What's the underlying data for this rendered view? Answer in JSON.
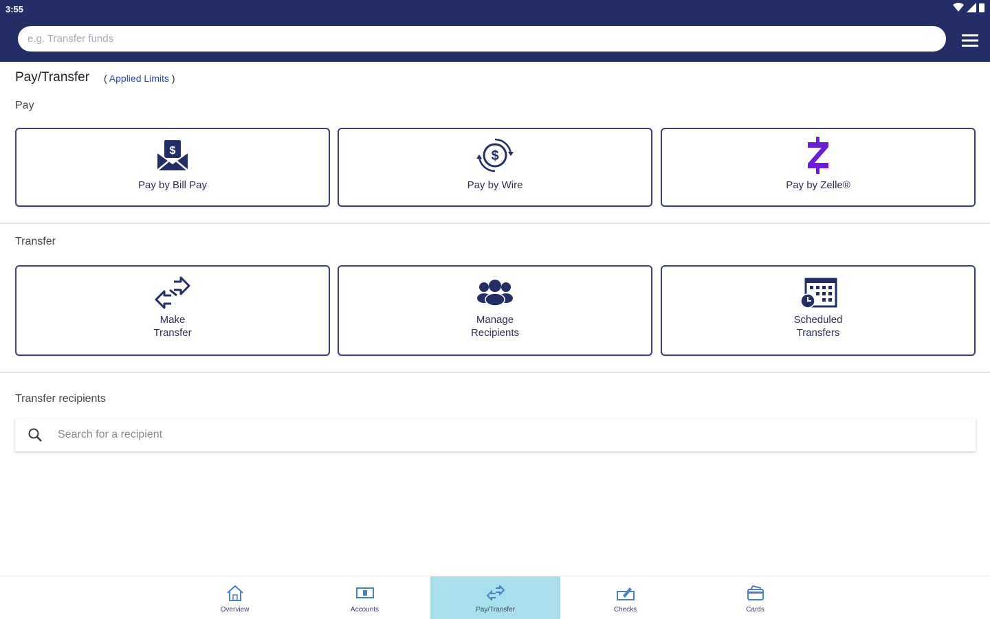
{
  "status_bar": {
    "time": "3:55"
  },
  "header": {
    "search_placeholder": "e.g. Transfer funds"
  },
  "page": {
    "title": "Pay/Transfer",
    "applied_limits_open": "( ",
    "applied_limits_link": "Applied Limits",
    "applied_limits_close": " )"
  },
  "pay_section": {
    "label": "Pay",
    "tiles": [
      {
        "label": "Pay by Bill Pay",
        "icon": "bill-pay-envelope-icon"
      },
      {
        "label": "Pay by Wire",
        "icon": "wire-dollar-icon"
      },
      {
        "label": "Pay by Zelle®",
        "icon": "zelle-icon"
      }
    ]
  },
  "transfer_section": {
    "label": "Transfer",
    "tiles": [
      {
        "label_line1": "Make",
        "label_line2": "Transfer",
        "icon": "transfer-arrows-icon"
      },
      {
        "label_line1": "Manage",
        "label_line2": "Recipients",
        "icon": "people-icon"
      },
      {
        "label_line1": "Scheduled",
        "label_line2": "Transfers",
        "icon": "calendar-clock-icon"
      }
    ]
  },
  "recipients": {
    "label": "Transfer recipients",
    "search_placeholder": "Search for a recipient"
  },
  "bottom_nav": {
    "items": [
      {
        "label": "Overview",
        "icon": "home-icon"
      },
      {
        "label": "Accounts",
        "icon": "accounts-icon"
      },
      {
        "label": "Pay/Transfer",
        "icon": "transfer-arrows-icon",
        "active": true
      },
      {
        "label": "Checks",
        "icon": "check-deposit-icon"
      },
      {
        "label": "Cards",
        "icon": "cards-icon"
      }
    ]
  },
  "colors": {
    "header_bg": "#232e66",
    "tile_border": "#3a4170",
    "zelle_purple": "#6d1ed4",
    "active_nav_bg": "#a9dfea",
    "link_blue": "#2f48a8"
  }
}
